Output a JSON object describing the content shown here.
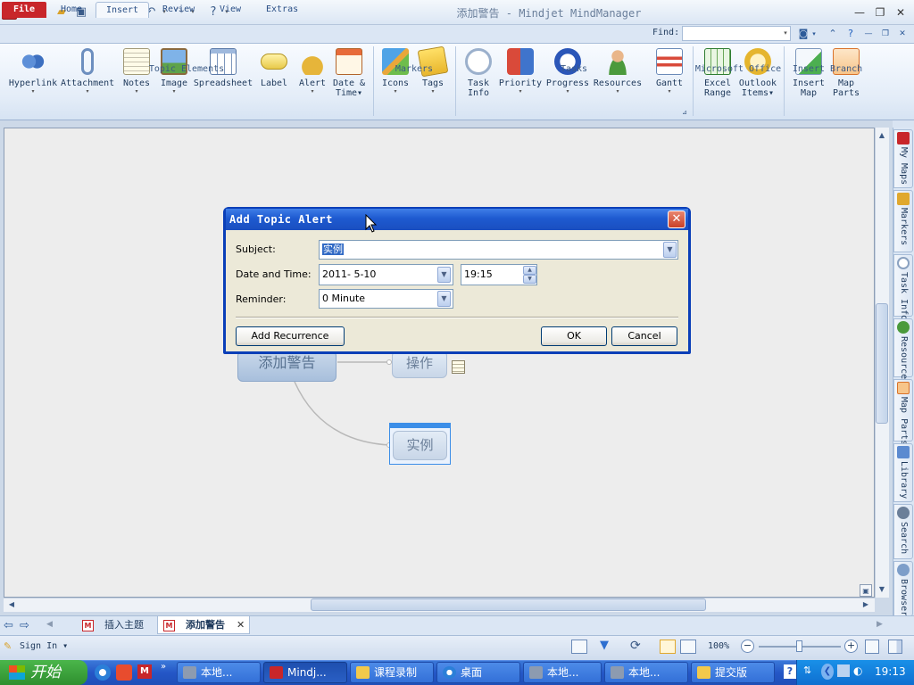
{
  "window": {
    "title": "添加警告 - Mindjet MindManager",
    "app_badge": "M"
  },
  "tabs": [
    {
      "label": "File"
    },
    {
      "label": "Home"
    },
    {
      "label": "Insert"
    },
    {
      "label": "Review"
    },
    {
      "label": "View"
    },
    {
      "label": "Extras"
    }
  ],
  "find": {
    "label": "Find:",
    "value": ""
  },
  "ribbon": {
    "topic_elements": {
      "label": "Topic Elements",
      "buttons": [
        "Hyperlink",
        "Attachment",
        "Notes",
        "Image",
        "Spreadsheet",
        "Label",
        "Alert",
        "Date &",
        "Time"
      ]
    },
    "markers": {
      "label": "Markers",
      "buttons": [
        "Icons",
        "Tags"
      ]
    },
    "tasks": {
      "label": "Tasks",
      "buttons": [
        "Task",
        "Info",
        "Priority",
        "Progress",
        "Resources",
        "Gantt"
      ]
    },
    "office": {
      "label": "Microsoft Office",
      "buttons": [
        "Excel",
        "Range",
        "Outlook",
        "Items"
      ]
    },
    "insert_branch": {
      "label": "Insert Branch",
      "buttons": [
        "Insert",
        "Map",
        "Map",
        "Parts"
      ]
    }
  },
  "map": {
    "central": "添加警告",
    "topic1": "操作",
    "topic2": "实例"
  },
  "side_tabs": [
    "My Maps",
    "Markers",
    "Task Info",
    "Resources",
    "Map Parts",
    "Library",
    "Search",
    "Browser"
  ],
  "doc_tabs": [
    "插入主题",
    "添加警告"
  ],
  "status": {
    "sign_in": "Sign In",
    "zoom": "100%"
  },
  "dialog": {
    "title": "Add Topic Alert",
    "subject_label": "Subject:",
    "subject_value": "实例",
    "datetime_label": "Date and Time:",
    "date_value": "2011- 5-10",
    "time_value": "19:15",
    "reminder_label": "Reminder:",
    "reminder_value": "0 Minute",
    "recurrence_button": "Add Recurrence",
    "ok_button": "OK",
    "cancel_button": "Cancel"
  },
  "taskbar": {
    "start": "开始",
    "items": [
      "本地...",
      "Mindj...",
      "课程录制",
      "桌面",
      "本地...",
      "本地...",
      "提交版"
    ],
    "clock": "19:13"
  },
  "colors": {
    "accent": "#c8262a",
    "ribbon_text": "#1e395b",
    "xp_blue": "#0a3fb8",
    "canvas": "#ededed"
  }
}
